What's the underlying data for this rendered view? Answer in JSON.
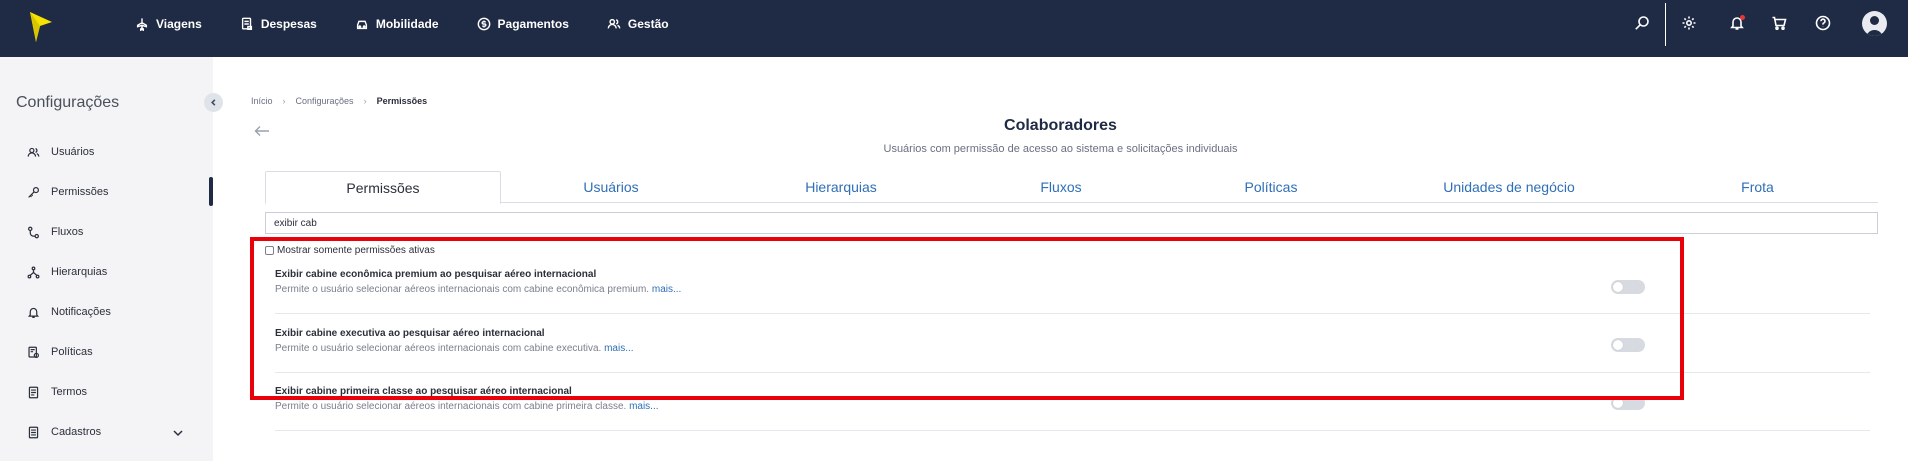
{
  "app": {
    "brand_color": "#1f2a44",
    "logo_color": "#f5e300",
    "highlight_color": "#e8000b",
    "link_color": "#2f6fb7"
  },
  "topnav": {
    "items": [
      {
        "label": "Viagens",
        "icon": "plane-icon"
      },
      {
        "label": "Despesas",
        "icon": "receipt-icon"
      },
      {
        "label": "Mobilidade",
        "icon": "car-icon"
      },
      {
        "label": "Pagamentos",
        "icon": "dollar-icon"
      },
      {
        "label": "Gestão",
        "icon": "users-icon"
      }
    ],
    "right_icons": [
      "search-icon",
      "gear-icon",
      "bell-icon",
      "cart-icon",
      "help-icon",
      "avatar-icon"
    ]
  },
  "sidebar": {
    "title": "Configurações",
    "active": "Permissões",
    "items": [
      {
        "label": "Usuários",
        "icon": "users-icon"
      },
      {
        "label": "Permissões",
        "icon": "key-icon"
      },
      {
        "label": "Fluxos",
        "icon": "flow-icon"
      },
      {
        "label": "Hierarquias",
        "icon": "hierarchy-icon"
      },
      {
        "label": "Notificações",
        "icon": "bell-icon"
      },
      {
        "label": "Políticas",
        "icon": "policy-icon"
      },
      {
        "label": "Termos",
        "icon": "document-icon"
      },
      {
        "label": "Cadastros",
        "icon": "folder-icon"
      }
    ]
  },
  "breadcrumb": {
    "items": [
      "Início",
      "Configurações",
      "Permissões"
    ]
  },
  "page": {
    "title": "Colaboradores",
    "subtitle": "Usuários com permissão de acesso ao sistema e solicitações individuais"
  },
  "tabs": {
    "active": "Permissões",
    "items": [
      "Permissões",
      "Usuários",
      "Hierarquias",
      "Fluxos",
      "Políticas",
      "Unidades de negócio",
      "Frota"
    ]
  },
  "search": {
    "value": "exibir cab"
  },
  "filter": {
    "label": "Mostrar somente permissões ativas",
    "checked": false
  },
  "permissions": [
    {
      "title": "Exibir cabine econômica premium ao pesquisar aéreo internacional",
      "description": "Permite o usuário selecionar aéreos internacionais com cabine econômica premium.",
      "more": "mais...",
      "enabled": false
    },
    {
      "title": "Exibir cabine executiva ao pesquisar aéreo internacional",
      "description": "Permite o usuário selecionar aéreos internacionais com cabine executiva.",
      "more": "mais...",
      "enabled": false
    },
    {
      "title": "Exibir cabine primeira classe ao pesquisar aéreo internacional",
      "description": "Permite o usuário selecionar aéreos internacionais com cabine primeira classe.",
      "more": "mais...",
      "enabled": false
    }
  ]
}
